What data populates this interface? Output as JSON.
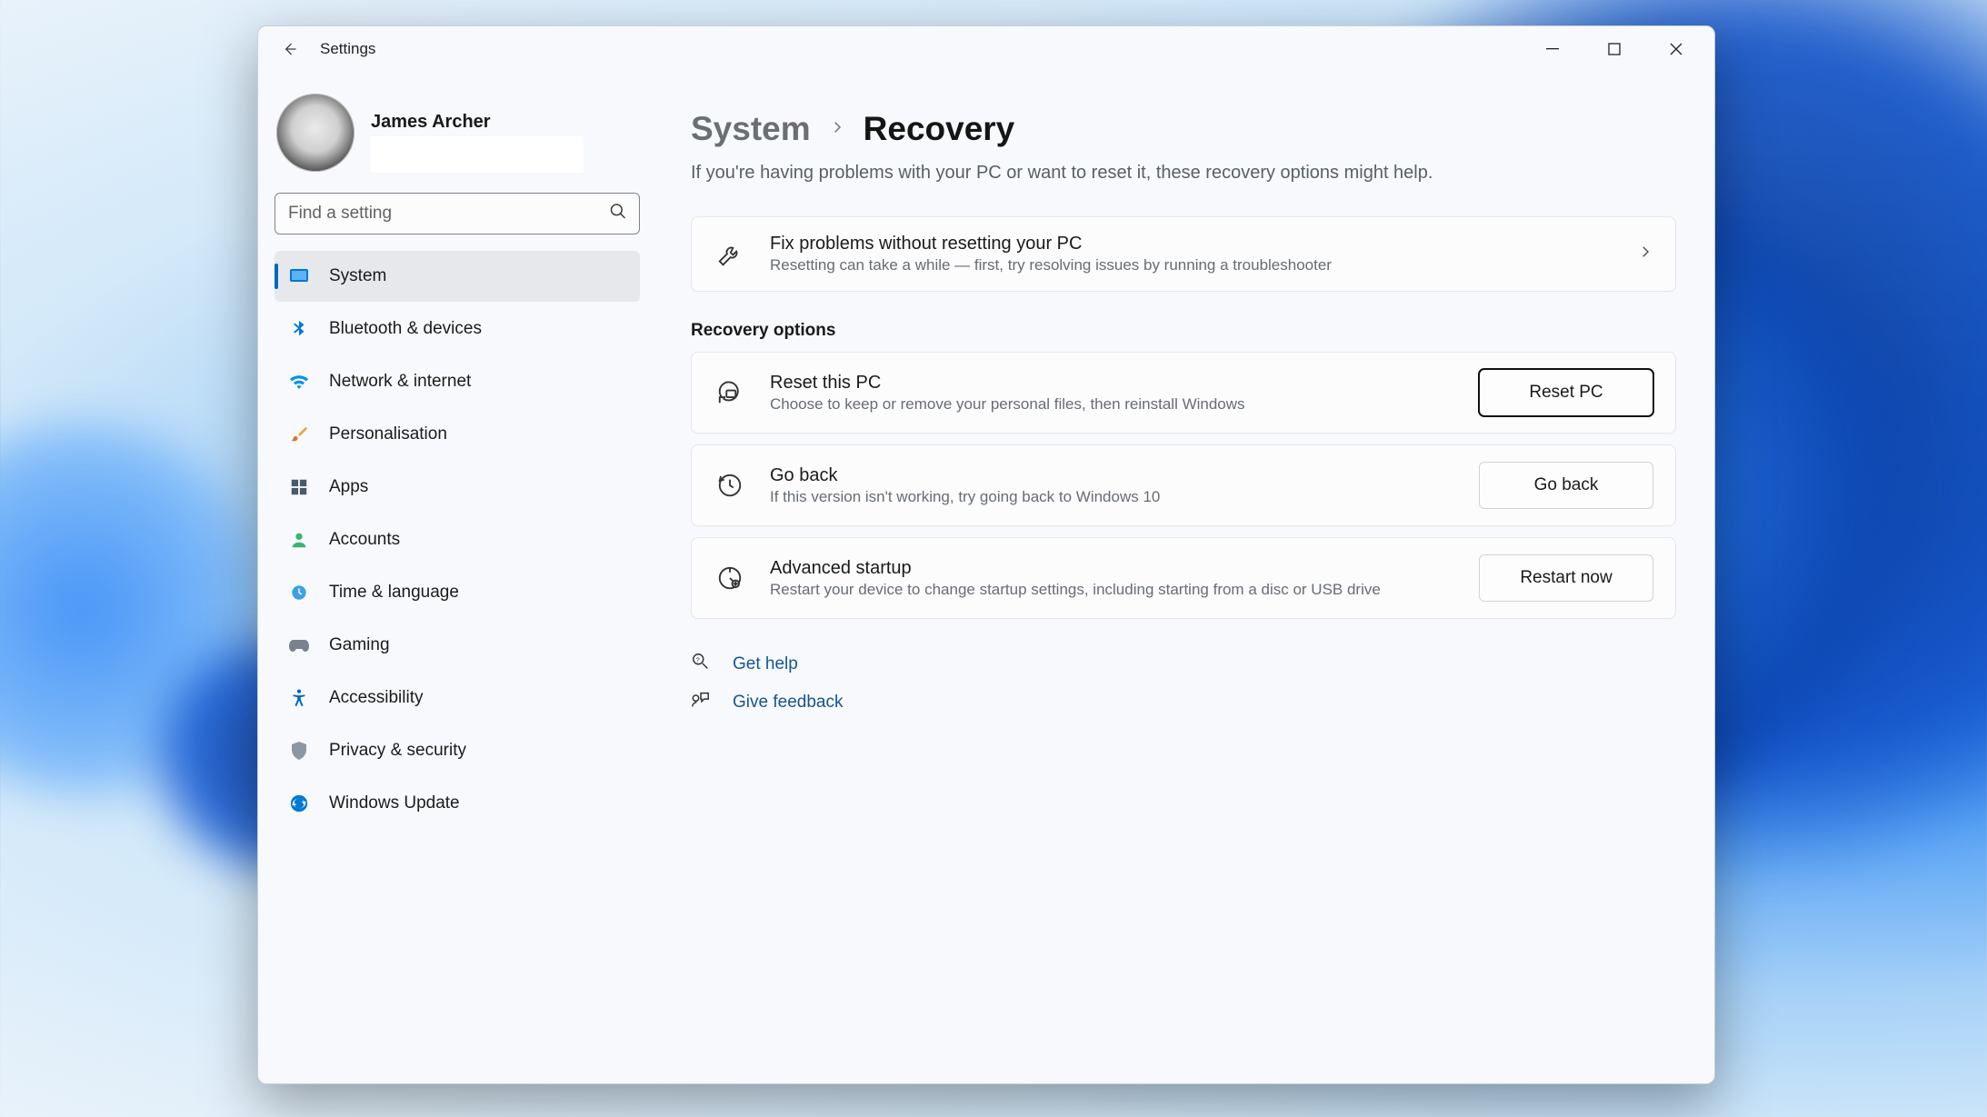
{
  "window": {
    "title": "Settings",
    "user_name": "James Archer",
    "search_placeholder": "Find a setting"
  },
  "nav": {
    "items": [
      {
        "label": "System",
        "icon": "system",
        "active": true
      },
      {
        "label": "Bluetooth & devices",
        "icon": "bluetooth"
      },
      {
        "label": "Network & internet",
        "icon": "wifi"
      },
      {
        "label": "Personalisation",
        "icon": "brush"
      },
      {
        "label": "Apps",
        "icon": "apps"
      },
      {
        "label": "Accounts",
        "icon": "account"
      },
      {
        "label": "Time & language",
        "icon": "time"
      },
      {
        "label": "Gaming",
        "icon": "gaming"
      },
      {
        "label": "Accessibility",
        "icon": "accessibility"
      },
      {
        "label": "Privacy & security",
        "icon": "privacy"
      },
      {
        "label": "Windows Update",
        "icon": "update"
      }
    ]
  },
  "breadcrumb": {
    "parent": "System",
    "current": "Recovery"
  },
  "subtitle": "If you're having problems with your PC or want to reset it, these recovery options might help.",
  "troubleshoot_card": {
    "title": "Fix problems without resetting your PC",
    "desc": "Resetting can take a while — first, try resolving issues by running a troubleshooter"
  },
  "section_label": "Recovery options",
  "options": [
    {
      "id": "reset",
      "title": "Reset this PC",
      "desc": "Choose to keep or remove your personal files, then reinstall Windows",
      "button": "Reset PC",
      "focus": true
    },
    {
      "id": "goback",
      "title": "Go back",
      "desc": "If this version isn't working, try going back to Windows 10",
      "button": "Go back"
    },
    {
      "id": "advanced",
      "title": "Advanced startup",
      "desc": "Restart your device to change startup settings, including starting from a disc or USB drive",
      "button": "Restart now"
    }
  ],
  "links": {
    "help": "Get help",
    "feedback": "Give feedback"
  }
}
